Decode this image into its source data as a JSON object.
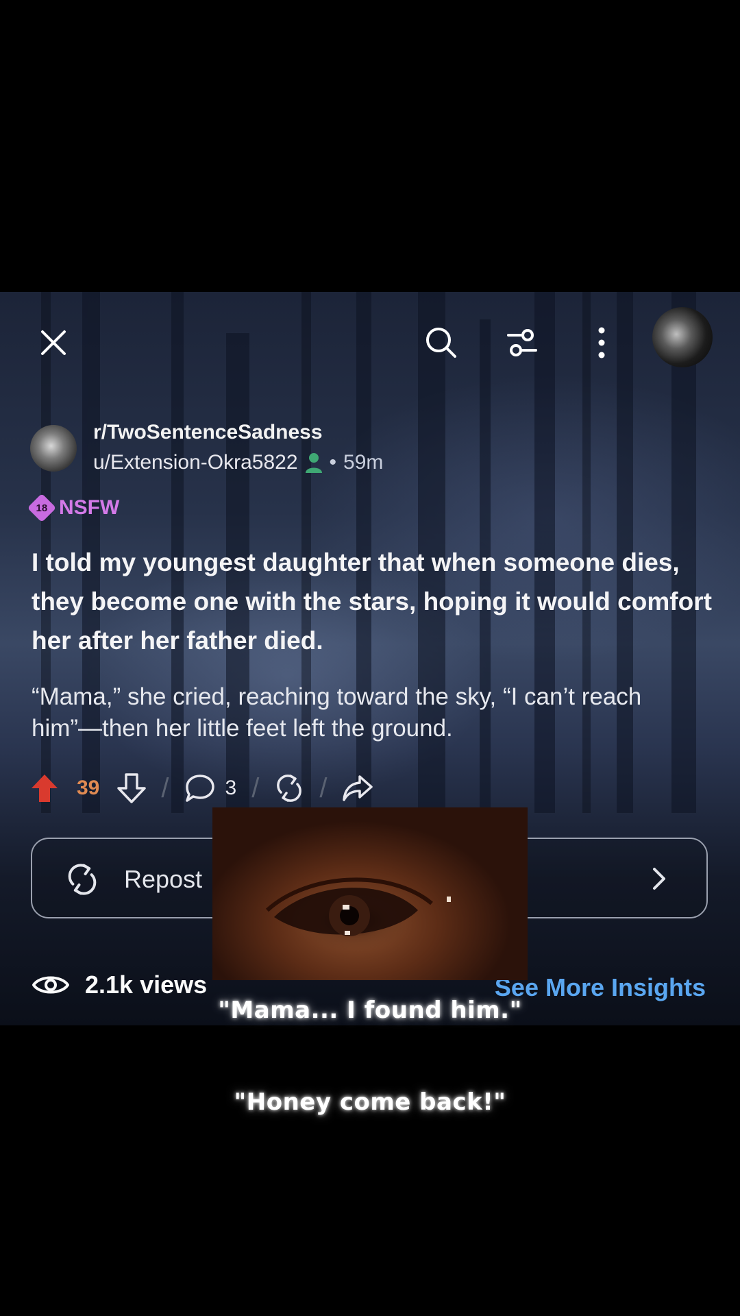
{
  "toolbar": {
    "close_icon": "close-icon",
    "search_icon": "search-icon",
    "filter_icon": "sliders-icon",
    "more_icon": "more-vertical-icon"
  },
  "post": {
    "subreddit": "r/TwoSentenceSadness",
    "username": "u/Extension-Okra5822",
    "separator": "•",
    "time": "59m",
    "nsfw_badge": "18",
    "nsfw_label": "NSFW",
    "title": "I told my youngest daughter that when someone dies, they become one with the stars, hoping it would comfort her after her father died.",
    "body": "“Mama,” she cried, reaching toward the sky, “I can’t reach him”—then her little feet left the ground."
  },
  "actions": {
    "score": "39",
    "comments": "3",
    "upvote_color": "#d93a2e",
    "score_color": "#e08a52"
  },
  "repost": {
    "label": "Repost"
  },
  "insights": {
    "views": "2.1k views",
    "link": "See More Insights",
    "link_color": "#5aa6f0"
  },
  "captions": {
    "line1": "\"Mama... I found him.\"",
    "line2": "\"Honey come back!\""
  }
}
